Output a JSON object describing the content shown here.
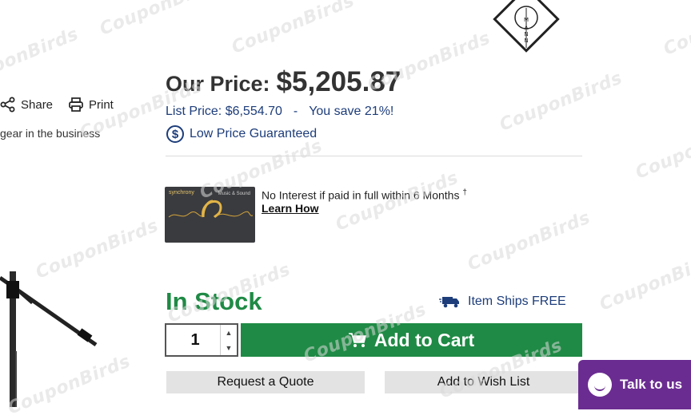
{
  "toolbar": {
    "share_label": "Share",
    "print_label": "Print"
  },
  "description_snippet": "gear in the business",
  "price": {
    "our_price_label": "Our Price:",
    "our_price_value": "$5,205.87",
    "list_price": "List Price: $6,554.70",
    "separator": "-",
    "savings": "You save 21%!",
    "guarantee_label": "Low Price Guaranteed",
    "guarantee_icon": "dollar-circle-icon"
  },
  "financing": {
    "card_brand": "synchrony",
    "card_tag": "Music & Sound",
    "text": "No Interest if paid in full within 6 Months",
    "footnote_mark": "†",
    "link_label": "Learn How"
  },
  "availability": {
    "status": "In Stock",
    "status_color": "#1f8a45",
    "shipping_label": "Item Ships FREE",
    "shipping_icon": "truck-icon"
  },
  "purchase": {
    "quantity": "1",
    "add_to_cart_label": "Add to Cart",
    "cart_icon": "cart-icon",
    "cart_color": "#1f8a45",
    "request_quote_label": "Request a Quote",
    "wish_list_label": "Add to Wish List"
  },
  "chat": {
    "label": "Talk to us",
    "color": "#6b2c91"
  },
  "watermark": "CouponBirds"
}
